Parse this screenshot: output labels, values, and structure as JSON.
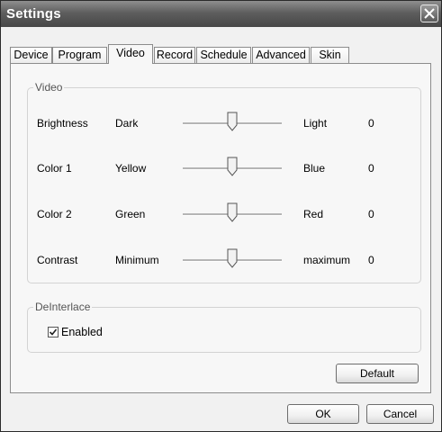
{
  "window": {
    "title": "Settings"
  },
  "tabs": [
    {
      "label": "Device"
    },
    {
      "label": "Program"
    },
    {
      "label": "Video",
      "active": true
    },
    {
      "label": "Record"
    },
    {
      "label": "Schedule"
    },
    {
      "label": "Advanced"
    },
    {
      "label": "Skin"
    }
  ],
  "video_group": {
    "label": "Video",
    "rows": [
      {
        "name": "Brightness",
        "min_label": "Dark",
        "max_label": "Light",
        "value": "0",
        "slider_position": 0.5
      },
      {
        "name": "Color 1",
        "min_label": "Yellow",
        "max_label": "Blue",
        "value": "0",
        "slider_position": 0.5
      },
      {
        "name": "Color 2",
        "min_label": "Green",
        "max_label": "Red",
        "value": "0",
        "slider_position": 0.5
      },
      {
        "name": "Contrast",
        "min_label": "Minimum",
        "max_label": "maximum",
        "value": "0",
        "slider_position": 0.5
      }
    ]
  },
  "deinterlace_group": {
    "label": "DeInterlace",
    "enabled_label": "Enabled",
    "enabled": true
  },
  "buttons": {
    "default_label": "Default",
    "ok_label": "OK",
    "cancel_label": "Cancel"
  },
  "icons": {
    "close": "close-icon",
    "checkmark": "checkmark-icon",
    "slider_thumb": "slider-thumb-icon"
  }
}
